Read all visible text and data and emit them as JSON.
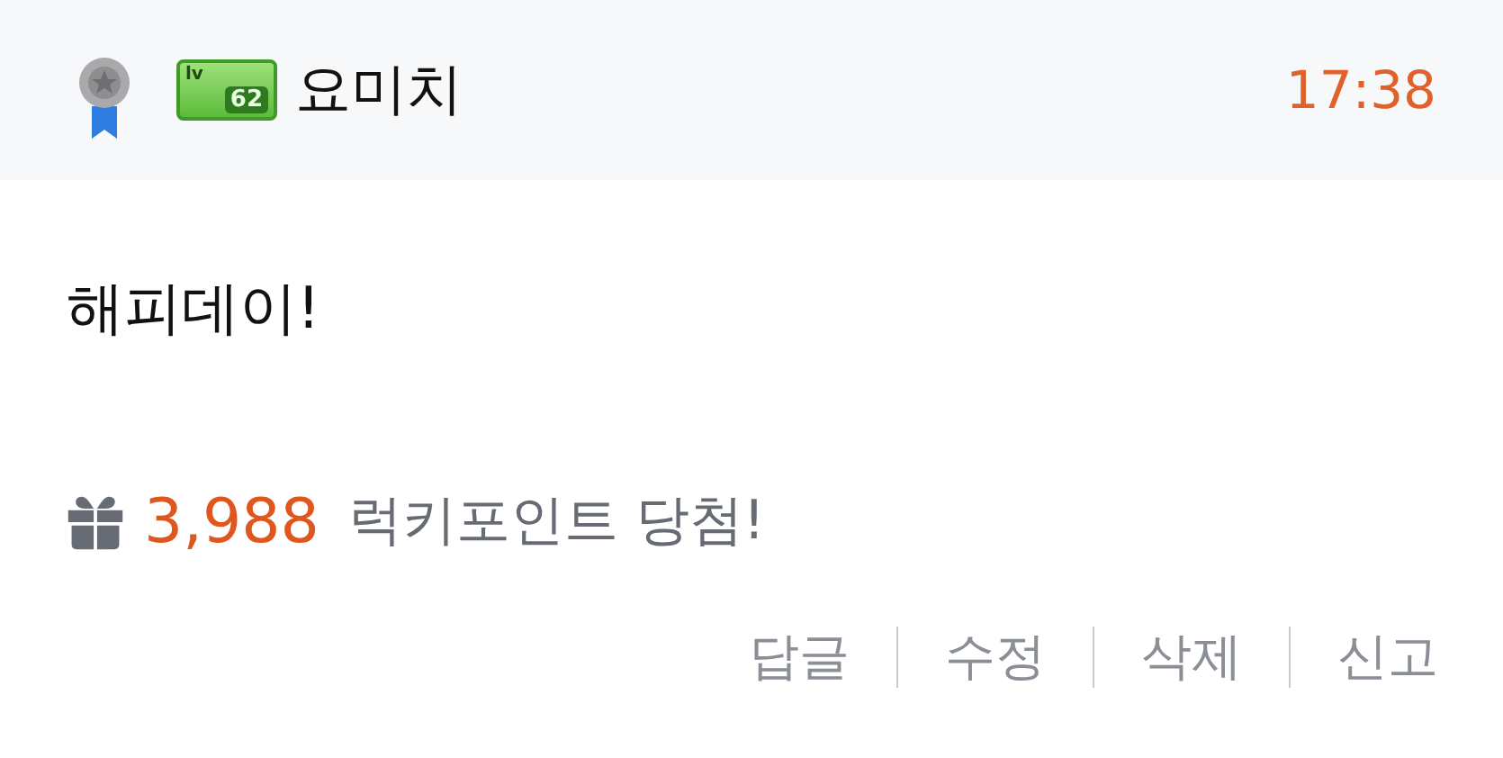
{
  "header": {
    "level_badge": {
      "prefix": "lv",
      "level": "62"
    },
    "username": "요미치",
    "time": "17:38"
  },
  "comment": {
    "text": "해피데이!"
  },
  "reward": {
    "points": "3,988",
    "label": "럭키포인트 당첨!"
  },
  "actions": [
    "답글",
    "수정",
    "삭제",
    "신고"
  ]
}
